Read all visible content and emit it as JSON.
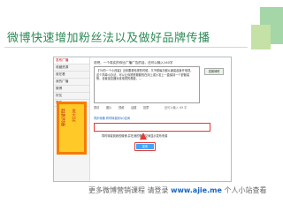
{
  "slide": {
    "title": "微博快速增加粉丝法以及做好品牌传播",
    "caption_prefix": "更多微博营销课程 请登录",
    "caption_link": "www.ajie.me",
    "caption_suffix": " 个人小站查看"
  },
  "screenshot": {
    "sidebar_tabs": [
      "发布广播",
      "收藏资源",
      "谁在看",
      "我的广播",
      "微博",
      "好友",
      "更多"
    ],
    "ad_text_1": "赶快注册",
    "ad_text_2": "发大奖",
    "prompt": "说吧，一个真实的你比广播广告的话，还可以输入140字",
    "compose_text": "【TV的一个小改装】当你要看电视的时候，又不想每次都从躺姿起身开电视，这个简单小办法，可以让你舒舒服服的在床上或沙发上一直保持一个舒服姿势，设置遥控器对准电视的角度，…",
    "side_button": "发微博吧",
    "tools": [
      "表情",
      "图片",
      "视频",
      "话题",
      "投票"
    ],
    "counter": "还可以输入 69 字",
    "options": "同步转播    同时转载到QQ空间",
    "highlight_label": "同时转载到我的微博,并在我的微博空间显示发布来源",
    "publish_label": "发布"
  },
  "colors": {
    "title": "#2e8b57",
    "link": "#1565c0",
    "highlight": "#e53935"
  }
}
